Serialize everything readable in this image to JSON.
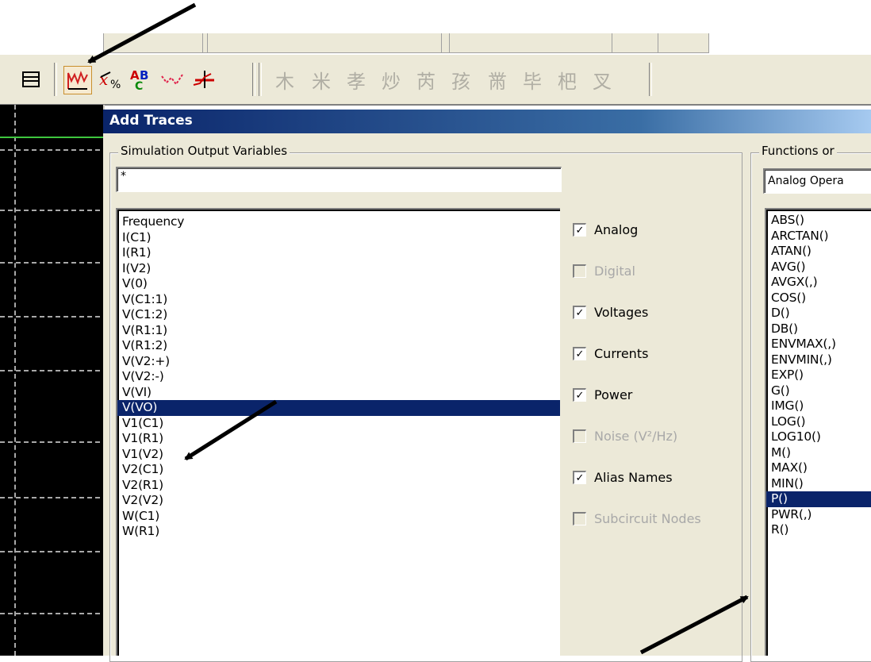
{
  "window": {
    "title": "Add Traces"
  },
  "toolbar": {
    "icons": [
      "list-icon",
      "add-trace-icon",
      "eval-icon",
      "label-icon",
      "marker-icon",
      "cursor-icon",
      "cursor-peak-icon",
      "cursor-trough-icon",
      "cursor-slope-icon",
      "cursor-min-icon",
      "cursor-max-icon",
      "cursor-point-icon",
      "cursor-search-icon",
      "cursor-next-icon",
      "cursor-mark-icon",
      "cursor-label-icon"
    ]
  },
  "output_vars": {
    "legend": "Simulation Output Variables",
    "filter_value": "*",
    "items": [
      "Frequency",
      "I(C1)",
      "I(R1)",
      "I(V2)",
      "V(0)",
      "V(C1:1)",
      "V(C1:2)",
      "V(R1:1)",
      "V(R1:2)",
      "V(V2:+)",
      "V(V2:-)",
      "V(VI)",
      "V(VO)",
      "V1(C1)",
      "V1(R1)",
      "V1(V2)",
      "V2(C1)",
      "V2(R1)",
      "V2(V2)",
      "W(C1)",
      "W(R1)"
    ],
    "selected": "V(VO)"
  },
  "filters": {
    "analog": {
      "label": "Analog",
      "checked": true,
      "enabled": true
    },
    "digital": {
      "label": "Digital",
      "checked": false,
      "enabled": false
    },
    "voltages": {
      "label": "Voltages",
      "checked": true,
      "enabled": true
    },
    "currents": {
      "label": "Currents",
      "checked": true,
      "enabled": true
    },
    "power": {
      "label": "Power",
      "checked": true,
      "enabled": true
    },
    "noise": {
      "label": "Noise (V²/Hz)",
      "checked": false,
      "enabled": false
    },
    "alias": {
      "label": "Alias Names",
      "checked": true,
      "enabled": true
    },
    "subckt": {
      "label": "Subcircuit Nodes",
      "checked": false,
      "enabled": false
    }
  },
  "functions": {
    "legend": "Functions or",
    "dropdown_value": "Analog Opera",
    "items": [
      "ABS()",
      "ARCTAN()",
      "ATAN()",
      "AVG()",
      "AVGX(,)",
      "COS()",
      "D()",
      "DB()",
      "ENVMAX(,)",
      "ENVMIN(,)",
      "EXP()",
      "G()",
      "IMG()",
      "LOG()",
      "LOG10()",
      "M()",
      "MAX()",
      "MIN()",
      "P()",
      "PWR(,)",
      "R()"
    ],
    "selected": "P()"
  },
  "colors": {
    "selection": "#0a246a",
    "dialog_bg": "#ece9d8",
    "title_start": "#0a246a",
    "grid_dash": "#a8a8a8",
    "trace_green": "#3ec63e"
  }
}
